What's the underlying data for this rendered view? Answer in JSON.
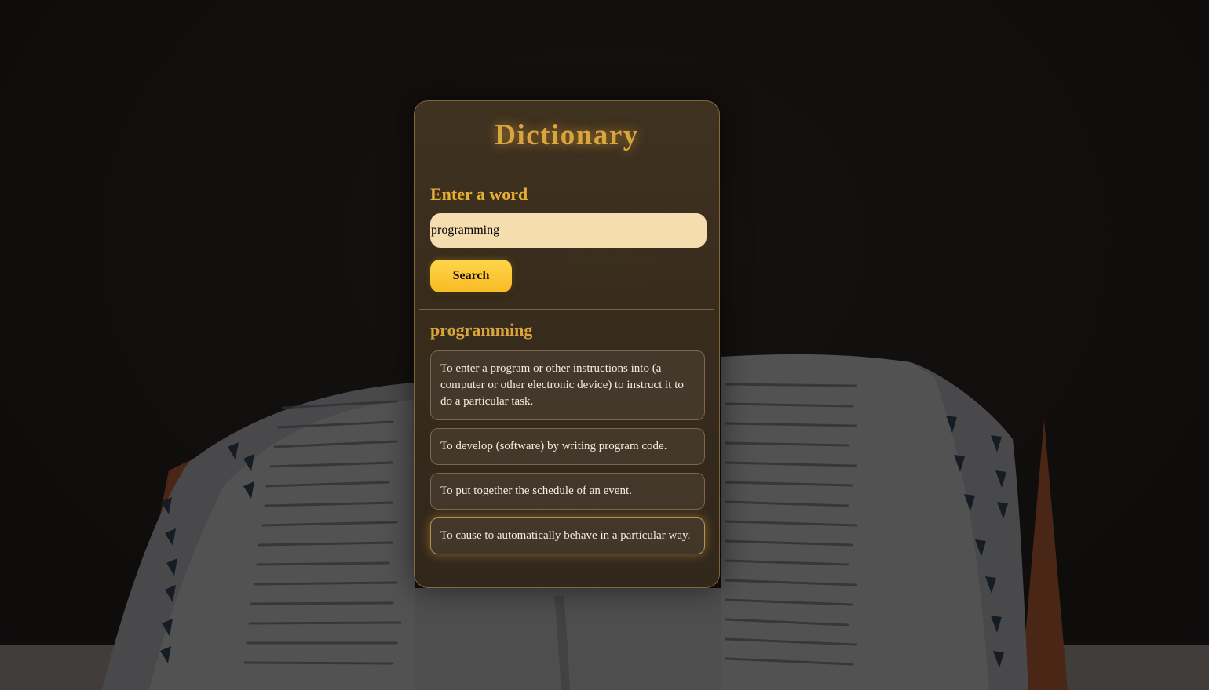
{
  "app": {
    "title": "Dictionary"
  },
  "search": {
    "label": "Enter a word",
    "value": "programming",
    "button_label": "Search"
  },
  "result": {
    "word": "programming",
    "definitions": [
      "To enter a program or other instructions into (a computer or other electronic device) to instruct it to do a particular task.",
      "To develop (software) by writing program code.",
      "To put together the schedule of an event.",
      "To cause to automatically behave in a particular way."
    ]
  },
  "colors": {
    "accent": "#d9a53c",
    "button": "#ffd54a",
    "input_background": "#f6ddb0",
    "card_background": "#3e3222"
  }
}
